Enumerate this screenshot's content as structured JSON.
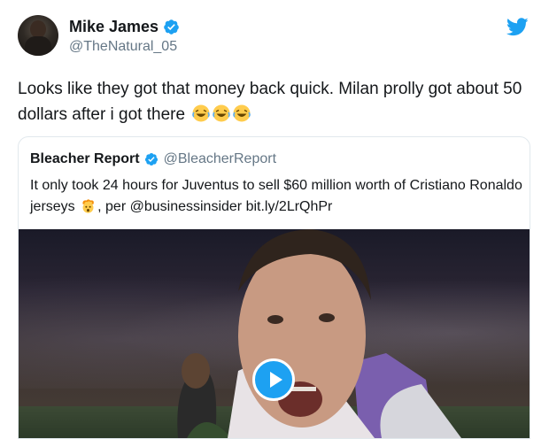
{
  "tweet": {
    "display_name": "Mike James",
    "handle": "@TheNatural_05",
    "text": "Looks like they got that money back quick. Milan prolly got about 50 dollars after i got there"
  },
  "quoted": {
    "display_name": "Bleacher Report",
    "handle": "@BleacherReport",
    "text_before": "It only took 24 hours for Juventus to sell $60 million worth of Cristiano Ronaldo jerseys",
    "text_after": ", per @businessinsider bit.ly/2LrQhPr"
  },
  "icons": {
    "verified": "verified-badge-icon",
    "bird": "twitter-bird-icon",
    "laugh_emoji": "face-with-tears-of-joy-emoji",
    "shock_emoji": "exploding-head-emoji",
    "play": "play-icon"
  },
  "colors": {
    "brand": "#1da1f2",
    "text": "#14171a",
    "muted": "#657786",
    "border": "#e1e8ed"
  }
}
